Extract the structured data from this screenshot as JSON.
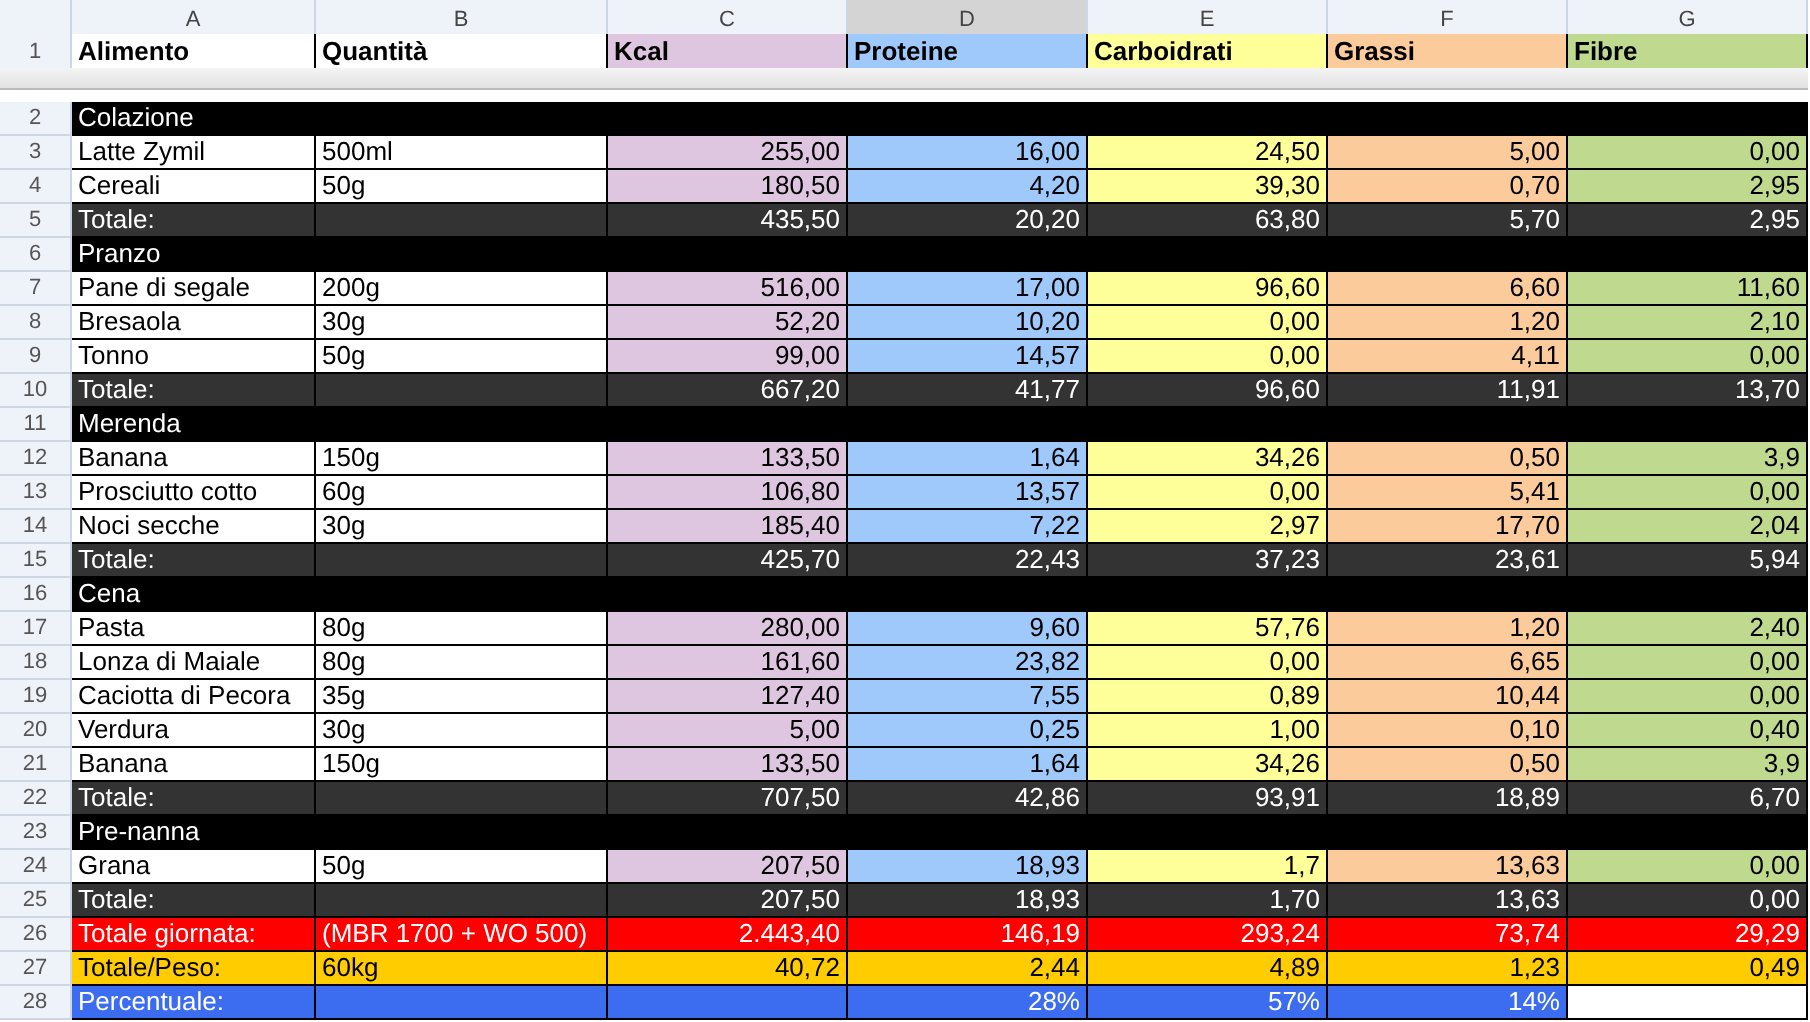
{
  "columns": [
    {
      "letter": "A",
      "selected": false
    },
    {
      "letter": "B",
      "selected": false
    },
    {
      "letter": "C",
      "selected": false,
      "color": "#dfc6e0"
    },
    {
      "letter": "D",
      "selected": true,
      "color": "#9fc9fb"
    },
    {
      "letter": "E",
      "selected": false,
      "color": "#ffff99"
    },
    {
      "letter": "F",
      "selected": false,
      "color": "#fccb9c"
    },
    {
      "letter": "G",
      "selected": false,
      "color": "#bfd98f"
    }
  ],
  "header_row": {
    "number": "1",
    "cells": [
      "Alimento",
      "Quantità",
      "Kcal",
      "Proteine",
      "Carboidrati",
      "Grassi",
      "Fibre"
    ]
  },
  "rows": [
    {
      "number": "2",
      "kind": "section",
      "cells": {
        "A": "Colazione"
      }
    },
    {
      "number": "3",
      "kind": "item",
      "cells": {
        "A": "Latte Zymil",
        "B": "500ml",
        "C": "255,00",
        "D": "16,00",
        "E": "24,50",
        "F": "5,00",
        "G": "0,00"
      }
    },
    {
      "number": "4",
      "kind": "item",
      "cells": {
        "A": "Cereali",
        "B": "50g",
        "C": "180,50",
        "D": "4,20",
        "E": "39,30",
        "F": "0,70",
        "G": "2,95"
      }
    },
    {
      "number": "5",
      "kind": "total",
      "cells": {
        "A": "Totale:",
        "C": "435,50",
        "D": "20,20",
        "E": "63,80",
        "F": "5,70",
        "G": "2,95"
      }
    },
    {
      "number": "6",
      "kind": "section",
      "cells": {
        "A": "Pranzo"
      }
    },
    {
      "number": "7",
      "kind": "item",
      "cells": {
        "A": "Pane di segale",
        "B": "200g",
        "C": "516,00",
        "D": "17,00",
        "E": "96,60",
        "F": "6,60",
        "G": "11,60"
      }
    },
    {
      "number": "8",
      "kind": "item",
      "cells": {
        "A": "Bresaola",
        "B": "30g",
        "C": "52,20",
        "D": "10,20",
        "E": "0,00",
        "F": "1,20",
        "G": "2,10"
      }
    },
    {
      "number": "9",
      "kind": "item",
      "cells": {
        "A": "Tonno",
        "B": "50g",
        "C": "99,00",
        "D": "14,57",
        "E": "0,00",
        "F": "4,11",
        "G": "0,00"
      }
    },
    {
      "number": "10",
      "kind": "total",
      "cells": {
        "A": "Totale:",
        "C": "667,20",
        "D": "41,77",
        "E": "96,60",
        "F": "11,91",
        "G": "13,70"
      }
    },
    {
      "number": "11",
      "kind": "section",
      "cells": {
        "A": "Merenda"
      }
    },
    {
      "number": "12",
      "kind": "item",
      "cells": {
        "A": "Banana",
        "B": "150g",
        "C": "133,50",
        "D": "1,64",
        "E": "34,26",
        "F": "0,50",
        "G": "3,9"
      }
    },
    {
      "number": "13",
      "kind": "item",
      "cells": {
        "A": "Prosciutto cotto",
        "B": "60g",
        "C": "106,80",
        "D": "13,57",
        "E": "0,00",
        "F": "5,41",
        "G": "0,00"
      }
    },
    {
      "number": "14",
      "kind": "item",
      "cells": {
        "A": "Noci secche",
        "B": "30g",
        "C": "185,40",
        "D": "7,22",
        "E": "2,97",
        "F": "17,70",
        "G": "2,04"
      }
    },
    {
      "number": "15",
      "kind": "total",
      "cells": {
        "A": "Totale:",
        "C": "425,70",
        "D": "22,43",
        "E": "37,23",
        "F": "23,61",
        "G": "5,94"
      }
    },
    {
      "number": "16",
      "kind": "section",
      "cells": {
        "A": "Cena"
      }
    },
    {
      "number": "17",
      "kind": "item",
      "cells": {
        "A": "Pasta",
        "B": "80g",
        "C": "280,00",
        "D": "9,60",
        "E": "57,76",
        "F": "1,20",
        "G": "2,40"
      }
    },
    {
      "number": "18",
      "kind": "item",
      "cells": {
        "A": "Lonza di Maiale",
        "B": "80g",
        "C": "161,60",
        "D": "23,82",
        "E": "0,00",
        "F": "6,65",
        "G": "0,00"
      }
    },
    {
      "number": "19",
      "kind": "item",
      "cells": {
        "A": "Caciotta di Pecora",
        "B": "35g",
        "C": "127,40",
        "D": "7,55",
        "E": "0,89",
        "F": "10,44",
        "G": "0,00"
      }
    },
    {
      "number": "20",
      "kind": "item",
      "cells": {
        "A": "Verdura",
        "B": "30g",
        "C": "5,00",
        "D": "0,25",
        "E": "1,00",
        "F": "0,10",
        "G": "0,40"
      }
    },
    {
      "number": "21",
      "kind": "item",
      "cells": {
        "A": "Banana",
        "B": "150g",
        "C": "133,50",
        "D": "1,64",
        "E": "34,26",
        "F": "0,50",
        "G": "3,9"
      }
    },
    {
      "number": "22",
      "kind": "total",
      "cells": {
        "A": "Totale:",
        "C": "707,50",
        "D": "42,86",
        "E": "93,91",
        "F": "18,89",
        "G": "6,70"
      }
    },
    {
      "number": "23",
      "kind": "section",
      "cells": {
        "A": "Pre-nanna"
      }
    },
    {
      "number": "24",
      "kind": "item",
      "cells": {
        "A": "Grana",
        "B": "50g",
        "C": "207,50",
        "D": "18,93",
        "E": "1,7",
        "F": "13,63",
        "G": "0,00"
      }
    },
    {
      "number": "25",
      "kind": "total",
      "cells": {
        "A": "Totale:",
        "C": "207,50",
        "D": "18,93",
        "E": "1,70",
        "F": "13,63",
        "G": "0,00"
      }
    },
    {
      "number": "26",
      "kind": "day_total",
      "cells": {
        "A": "Totale giornata:",
        "B": "(MBR 1700 + WO 500)",
        "C": "2.443,40",
        "D": "146,19",
        "E": "293,24",
        "F": "73,74",
        "G": "29,29"
      }
    },
    {
      "number": "27",
      "kind": "per_weight",
      "cells": {
        "A": "Totale/Peso:",
        "B": "60kg",
        "C": "40,72",
        "D": "2,44",
        "E": "4,89",
        "F": "1,23",
        "G": "0,49"
      }
    },
    {
      "number": "28",
      "kind": "percent",
      "cells": {
        "A": "Percentuale:",
        "D": "28%",
        "E": "57%",
        "F": "14%"
      }
    }
  ]
}
